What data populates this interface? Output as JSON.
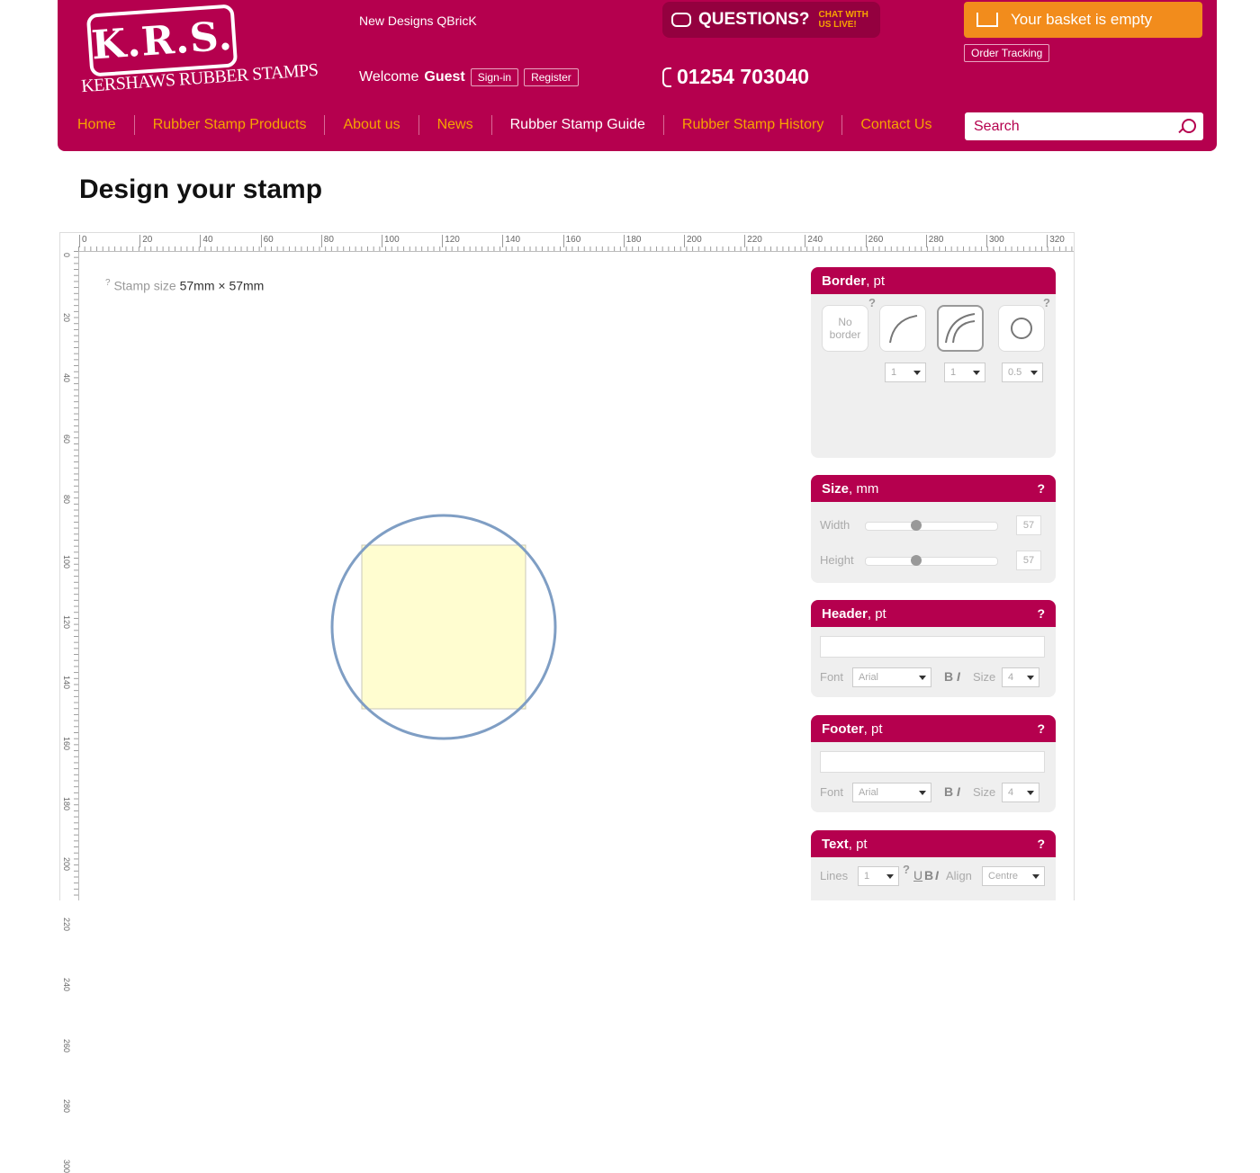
{
  "header": {
    "logo_text": "K.R.S.",
    "logo_subtitle": "KERSHAWS RUBBER STAMPS",
    "new_designs": "New Designs QBricK",
    "welcome_prefix": "Welcome",
    "welcome_user": "Guest",
    "sign_in": "Sign-in",
    "register": "Register",
    "questions": "QUESTIONS?",
    "chat_line1": "CHAT WITH",
    "chat_line2": "US LIVE!",
    "phone": "01254 703040",
    "basket": "Your basket is empty",
    "order_tracking": "Order Tracking",
    "search_placeholder": "Search"
  },
  "nav": [
    {
      "label": "Home"
    },
    {
      "label": "Rubber Stamp Products"
    },
    {
      "label": "About us"
    },
    {
      "label": "News"
    },
    {
      "label": "Rubber Stamp Guide"
    },
    {
      "label": "Rubber Stamp History"
    },
    {
      "label": "Contact Us"
    }
  ],
  "page_title": "Design your stamp",
  "ruler": {
    "top_ticks": [
      "0",
      "20",
      "40",
      "60",
      "80",
      "100",
      "120",
      "140",
      "160",
      "180",
      "200",
      "220",
      "240",
      "260",
      "280",
      "300",
      "320"
    ],
    "left_ticks": [
      "0",
      "20",
      "40",
      "60",
      "80",
      "100",
      "120",
      "140",
      "160",
      "180",
      "200",
      "220",
      "240",
      "260",
      "280",
      "300"
    ]
  },
  "canvas": {
    "stamp_size_label": "Stamp size",
    "stamp_size_value": "57mm × 57mm"
  },
  "border_panel": {
    "title": "Border",
    "unit": ", pt",
    "no_border": "No border",
    "selects": [
      "1",
      "1",
      "0.5"
    ]
  },
  "size_panel": {
    "title": "Size",
    "unit": ", mm",
    "width_label": "Width",
    "height_label": "Height",
    "width_value": "57",
    "height_value": "57"
  },
  "header_panel": {
    "title": "Header",
    "unit": ", pt",
    "font_label": "Font",
    "font_value": "Arial",
    "bold": "B",
    "italic": "I",
    "size_label": "Size",
    "size_value": "4"
  },
  "footer_panel": {
    "title": "Footer",
    "unit": ", pt",
    "font_label": "Font",
    "font_value": "Arial",
    "bold": "B",
    "italic": "I",
    "size_label": "Size",
    "size_value": "4"
  },
  "text_panel": {
    "title": "Text",
    "unit": ", pt",
    "lines_label": "Lines",
    "lines_value": "1",
    "underline": "U",
    "bold": "B",
    "italic": "I",
    "align_label": "Align",
    "align_value": "Centre"
  },
  "help": "?",
  "colors": {
    "brand": "#b5004e",
    "accent": "#f7a400",
    "basket": "#f28c1c",
    "stamp_fill": "#fffdd0",
    "stamp_circle": "#7f9ec4"
  }
}
